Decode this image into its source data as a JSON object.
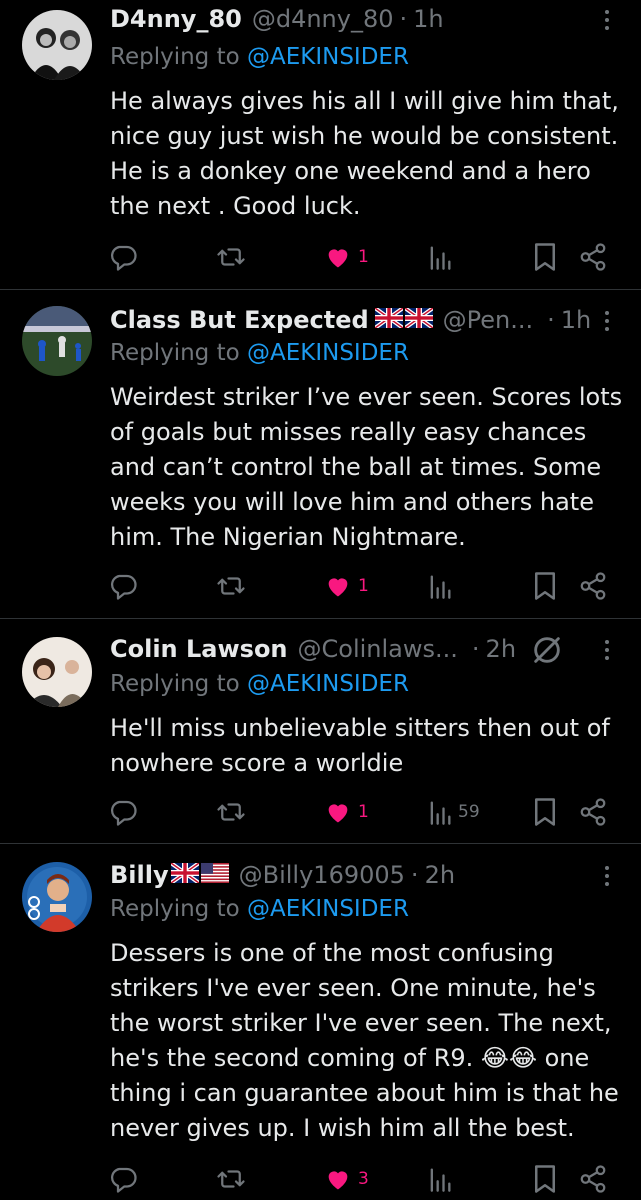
{
  "tweets": [
    {
      "name": "D4nny_80",
      "handle": "@d4nny_80",
      "time": "1h",
      "replying_prefix": "Replying to",
      "replying_to": "@AEKINSIDER",
      "text": "He always gives his all I will give him that, nice guy just wish he would be consistent. He is a donkey one weekend and  a hero the next . Good luck.",
      "likes": "1",
      "views": ""
    },
    {
      "name": "Class But Expected",
      "handle": "@Pen...",
      "time": "1h",
      "replying_prefix": "Replying to",
      "replying_to": "@AEKINSIDER",
      "text": "Weirdest striker I’ve ever seen. Scores lots of goals but misses really easy chances and can’t control the ball at times. Some weeks you will love him and others hate him. The Nigerian Nightmare.",
      "likes": "1",
      "views": ""
    },
    {
      "name": "Colin Lawson",
      "handle": "@Colinlaws...",
      "time": "2h",
      "replying_prefix": "Replying to",
      "replying_to": "@AEKINSIDER",
      "text": "He'll miss unbelievable sitters then out of nowhere score a worldie",
      "likes": "1",
      "views": "59"
    },
    {
      "name": "Billy",
      "handle": "@Billy169005",
      "time": "2h",
      "replying_prefix": "Replying to",
      "replying_to": "@AEKINSIDER",
      "text": "Dessers is one of the most confusing strikers I've ever seen. One minute, he's the worst striker I've ever seen. The next, he's the second coming of R9. 😂😂 one thing i can guarantee about him is that he never gives up. I wish him all the best.",
      "likes": "3",
      "views": ""
    }
  ],
  "colors": {
    "accent": "#1d9bf0",
    "like": "#f91880",
    "muted": "#71767b",
    "text": "#e7e9ea",
    "background": "#000000"
  }
}
